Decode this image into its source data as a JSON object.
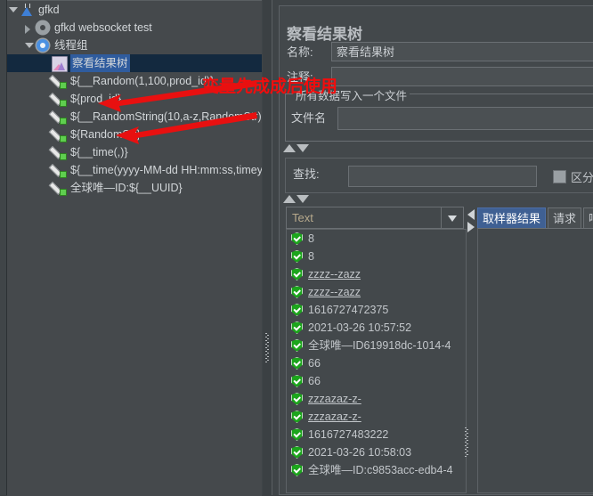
{
  "app": {
    "theme_bg": "#3f4447",
    "accent": "#3f6093",
    "annotation_color": "#f20d0d"
  },
  "tree": {
    "items": [
      {
        "label": "gfkd",
        "icon": "flask-icon",
        "indent": 26,
        "twisty": "down",
        "selected": false
      },
      {
        "label": "gfkd websocket test",
        "icon": "gear-icon",
        "indent": 44,
        "twisty": "right",
        "selected": false
      },
      {
        "label": "线程组",
        "icon": "gear-blue-icon",
        "indent": 44,
        "twisty": "down",
        "selected": false
      },
      {
        "label": "察看结果树",
        "icon": "results-tree-icon",
        "indent": 62,
        "twisty": "none",
        "selected": true
      },
      {
        "label": "${__Random(1,100,prod_id)}",
        "icon": "pencil-icon",
        "indent": 62,
        "twisty": "none",
        "selected": false
      },
      {
        "label": "${prod_id}",
        "icon": "pencil-icon",
        "indent": 62,
        "twisty": "none",
        "selected": false
      },
      {
        "label": "${__RandomString(10,a-z,RandomStr)}",
        "icon": "pencil-icon",
        "indent": 62,
        "twisty": "none",
        "selected": false
      },
      {
        "label": "${RandomStr}",
        "icon": "pencil-icon",
        "indent": 62,
        "twisty": "none",
        "selected": false
      },
      {
        "label": "${__time(,)}",
        "icon": "pencil-icon",
        "indent": 62,
        "twisty": "none",
        "selected": false
      },
      {
        "label": "${__time(yyyy-MM-dd HH:mm:ss,timeymd)}",
        "icon": "pencil-icon",
        "indent": 62,
        "twisty": "none",
        "selected": false
      },
      {
        "label": "全球唯—ID:${__UUID}",
        "icon": "pencil-icon",
        "indent": 62,
        "twisty": "none",
        "selected": false
      }
    ]
  },
  "annotation": {
    "text": "变量先成成后使用"
  },
  "panel": {
    "title": "察看结果树",
    "name_label": "名称:",
    "name_value": "察看结果树",
    "comment_label": "注释:",
    "comment_value": "",
    "file_group_title": "所有数据写入一个文件",
    "file_name_label": "文件名",
    "file_name_value": "",
    "search_label": "查找:",
    "search_value": "",
    "case_sensitive_label": "区分大",
    "combo_value": "Text",
    "tabs": [
      {
        "label": "取样器结果",
        "active": true
      },
      {
        "label": "请求",
        "active": false
      },
      {
        "label": "响",
        "active": false
      }
    ],
    "results": [
      {
        "text": "8",
        "style": "plain"
      },
      {
        "text": "8",
        "style": "plain"
      },
      {
        "text": "zzzz--zazz",
        "style": "link"
      },
      {
        "text": "zzzz--zazz",
        "style": "link"
      },
      {
        "text": "1616727472375",
        "style": "plain"
      },
      {
        "text": "2021-03-26 10:57:52",
        "style": "plain"
      },
      {
        "text": "全球唯—ID619918dc-1014-4",
        "style": "plain"
      },
      {
        "text": "66",
        "style": "plain"
      },
      {
        "text": "66",
        "style": "plain"
      },
      {
        "text": "zzzazaz-z-",
        "style": "link"
      },
      {
        "text": "zzzazaz-z-",
        "style": "link"
      },
      {
        "text": "1616727483222",
        "style": "plain"
      },
      {
        "text": "2021-03-26 10:58:03",
        "style": "plain"
      },
      {
        "text": "全球唯—ID:c9853acc-edb4-4",
        "style": "plain"
      }
    ]
  }
}
